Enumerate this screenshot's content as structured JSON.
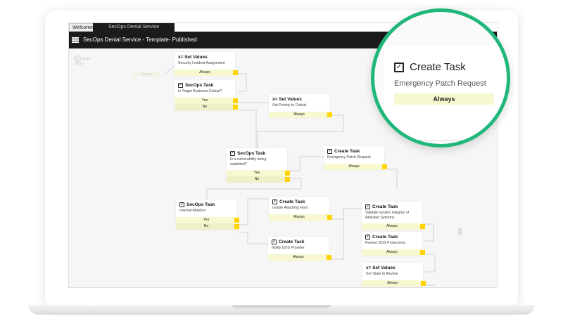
{
  "tabs": [
    {
      "label": "Welcome"
    },
    {
      "label": "SecOps Denial Service"
    }
  ],
  "header": {
    "title": "SecOps Denial Service - Template- Published"
  },
  "ghost": {
    "begin_icon_label": "Begin",
    "begin_label": "Begin",
    "always": "Always"
  },
  "nodes": [
    {
      "type": "set-values",
      "title": "x= Set Values",
      "subtitle": "Security Incident Assignment",
      "outputs": [
        "Always"
      ]
    },
    {
      "type": "secops-task",
      "title": "SecOps Task",
      "subtitle": "Is Target Business Critical?",
      "outputs": [
        "Yes",
        "No"
      ]
    },
    {
      "type": "set-values",
      "title": "x= Set Values",
      "subtitle": "Set Priority to Critical",
      "outputs": [
        "Always"
      ]
    },
    {
      "type": "secops-task",
      "title": "SecOps Task",
      "subtitle": "Is a vulnerability being exploited?",
      "outputs": [
        "Yes",
        "No"
      ]
    },
    {
      "type": "create-task",
      "title": "Create Task",
      "subtitle": "Emergency Patch Request",
      "outputs": [
        "Always"
      ]
    },
    {
      "type": "secops-task",
      "title": "SecOps Task",
      "subtitle": "Internal Attacker",
      "outputs": [
        "Yes",
        "No"
      ]
    },
    {
      "type": "create-task",
      "title": "Create Task",
      "subtitle": "Isolate Attacking Host",
      "outputs": [
        "Always"
      ]
    },
    {
      "type": "create-task",
      "title": "Create Task",
      "subtitle": "Notify DOS Provider",
      "outputs": [
        "Always"
      ]
    },
    {
      "type": "create-task",
      "title": "Create Task",
      "subtitle": "Validate system Integrity of Attacked Systems",
      "outputs": [
        "Always"
      ]
    },
    {
      "type": "create-task",
      "title": "Create Task",
      "subtitle": "Review DOS Protections",
      "outputs": [
        "Always"
      ]
    },
    {
      "type": "set-values",
      "title": "x= Set Values",
      "subtitle": "Set State to Review",
      "outputs": [
        "Always"
      ]
    }
  ],
  "magnifier": {
    "title": "Create Task",
    "subtitle": "Emergency Patch Request",
    "output": "Always",
    "border_color": "#20b87a"
  },
  "colors": {
    "port": "#ffd400",
    "output_bg": "#f8f8d0",
    "header_bg": "#1b1b1b"
  }
}
